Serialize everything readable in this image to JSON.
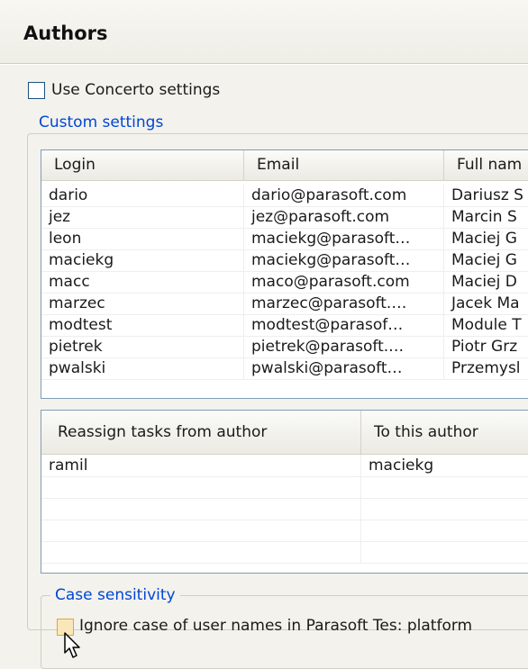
{
  "section_title": "Authors",
  "use_concerto": {
    "label": "Use Concerto settings",
    "checked": false
  },
  "custom_settings": {
    "legend": "Custom settings",
    "authors_table": {
      "columns": [
        "Login",
        "Email",
        "Full nam"
      ],
      "rows": [
        [
          "dario",
          "dario@parasoft.com",
          "Dariusz S"
        ],
        [
          "jez",
          "jez@parasoft.com",
          "Marcin S"
        ],
        [
          "leon",
          "maciekg@parasoft…",
          "Maciej G"
        ],
        [
          "maciekg",
          "maciekg@parasoft…",
          "Maciej G"
        ],
        [
          "macc",
          "maco@parasoft.com",
          "Maciej D"
        ],
        [
          "marzec",
          "marzec@parasoft.…",
          "Jacek Ma"
        ],
        [
          "modtest",
          "modtest@parasof…",
          "Module T"
        ],
        [
          "pietrek",
          "pietrek@parasoft.…",
          "Piotr Grz"
        ],
        [
          "pwalski",
          "pwalski@parasoft…",
          "Przemysl"
        ]
      ]
    },
    "reassign_table": {
      "columns": [
        "Reassign tasks from author",
        "To this author"
      ],
      "rows": [
        [
          "ramil",
          "maciekg"
        ],
        [
          "",
          ""
        ],
        [
          "",
          ""
        ],
        [
          "",
          ""
        ],
        [
          "",
          ""
        ]
      ]
    }
  },
  "case_sensitivity": {
    "legend": "Case sensitivity",
    "ignore_case": {
      "label": "Ignore case of user names in Parasoft Tes: platform",
      "checked": false
    }
  }
}
